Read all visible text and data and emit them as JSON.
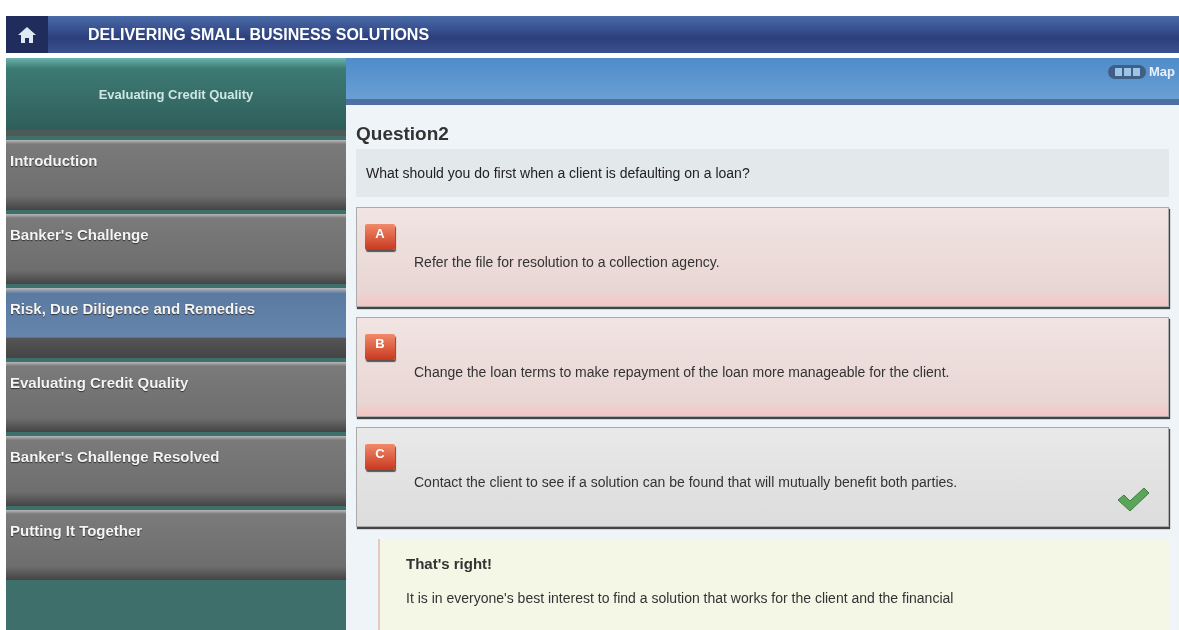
{
  "header": {
    "title": "DELIVERING SMALL BUSINESS SOLUTIONS"
  },
  "sidebar": {
    "title": "Evaluating Credit Quality",
    "items": [
      {
        "label": "Introduction",
        "selected": false
      },
      {
        "label": "Banker's Challenge",
        "selected": false
      },
      {
        "label": "Risk, Due Diligence and Remedies",
        "selected": true
      },
      {
        "label": "Evaluating Credit Quality",
        "selected": false
      },
      {
        "label": "Banker's Challenge Resolved",
        "selected": false
      },
      {
        "label": "Putting It Together",
        "selected": false
      }
    ]
  },
  "toolbar": {
    "map_label": "Map"
  },
  "question": {
    "title": "Question2",
    "prompt": "What should you do first when a client is defaulting on a loan?",
    "options": [
      {
        "letter": "A",
        "text": "Refer the file for resolution to a collection agency.",
        "correct": false
      },
      {
        "letter": "B",
        "text": "Change the loan terms to make repayment of the loan more manageable for the client.",
        "correct": false
      },
      {
        "letter": "C",
        "text": "Contact the client to see if a solution can be found that will mutually benefit both parties.",
        "correct": true
      }
    ]
  },
  "feedback": {
    "title": "That's right!",
    "text": "It is in everyone's best interest to find a solution that works for the client and the financial"
  }
}
